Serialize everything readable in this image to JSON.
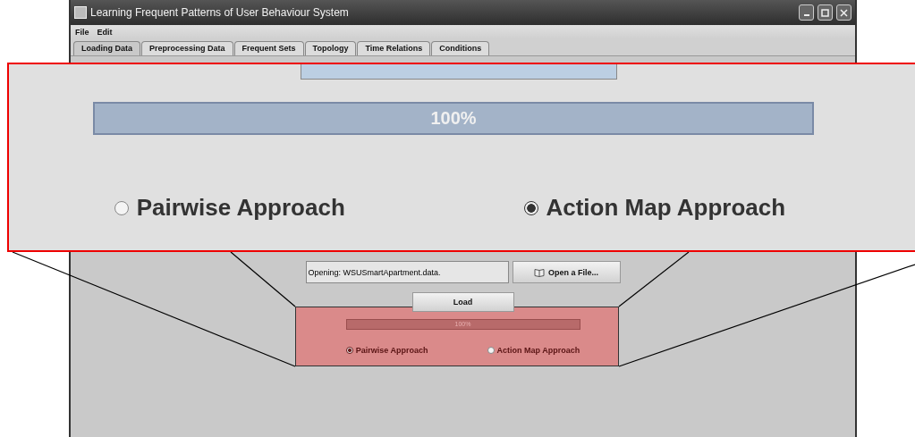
{
  "window": {
    "title": "Learning Frequent Patterns of User Behaviour System"
  },
  "menu": [
    "File",
    "Edit"
  ],
  "tabs": [
    {
      "label": "Loading Data",
      "selected": true
    },
    {
      "label": "Preprocessing Data",
      "selected": false
    },
    {
      "label": "Frequent Sets",
      "selected": false
    },
    {
      "label": "Topology",
      "selected": false
    },
    {
      "label": "Time Relations",
      "selected": false
    },
    {
      "label": "Conditions",
      "selected": false
    }
  ],
  "file_field": {
    "value": "Opening: WSUSmartApartment.data."
  },
  "open_button": {
    "label": "Open a File..."
  },
  "load_button": {
    "label": "Load"
  },
  "progress": {
    "level": 1,
    "reading": "100%"
  },
  "approaches": [
    {
      "label": "Pairwise Approach",
      "selected": true
    },
    {
      "label": "Action Map Approach",
      "selected": false
    }
  ],
  "zoom_callout": {
    "progress": {
      "level": 1,
      "reading": "100%"
    },
    "approaches": [
      {
        "label": "Pairwise Approach",
        "selected": false
      },
      {
        "label": "Action Map Approach",
        "selected": true
      }
    ]
  }
}
